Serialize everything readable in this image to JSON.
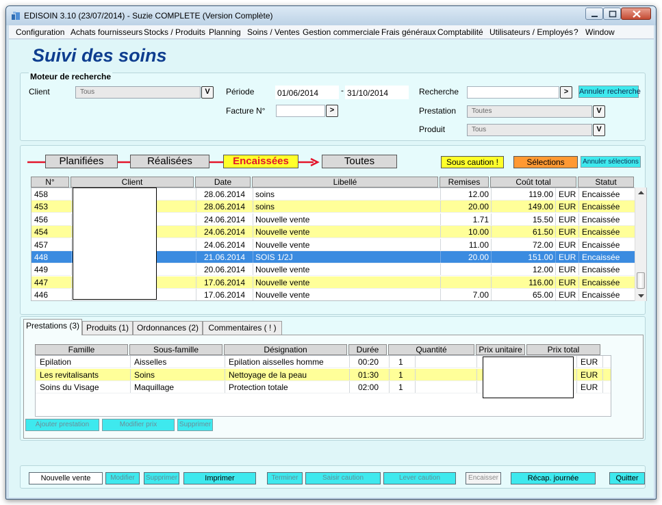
{
  "window": {
    "title": "EDISOIN 3.10 (23/07/2014) - Suzie COMPLETE (Version Complète)"
  },
  "menu": [
    "Configuration",
    "Achats fournisseurs",
    "Stocks / Produits",
    "Planning",
    "Soins / Ventes",
    "Gestion commerciale",
    "Frais généraux",
    "Comptabilité",
    "Utilisateurs / Employés",
    "?",
    "Window"
  ],
  "page_title": "Suivi des soins",
  "search": {
    "group_title": "Moteur de recherche",
    "client_label": "Client",
    "client_value": "Tous",
    "combo_btn": "V",
    "periode_label": "Période",
    "date_from": "01/06/2014",
    "date_sep": "-",
    "date_to": "31/10/2014",
    "facture_label": "Facture N°",
    "facture_value": "",
    "go_btn": ">",
    "recherche_label": "Recherche",
    "recherche_value": "",
    "annuler_recherche": "Annuler recherche",
    "prestation_label": "Prestation",
    "prestation_value": "Toutes",
    "produit_label": "Produit",
    "produit_value": "Tous"
  },
  "filters": {
    "planifiees": "Planifiées",
    "realisees": "Réalisées",
    "encaissees": "Encaissées",
    "toutes": "Toutes",
    "active": "encaissees",
    "sous_caution": "Sous caution !",
    "selections": "Sélections",
    "annuler_selections": "Annuler sélections"
  },
  "colors": {
    "accent_cyan": "#3ee9ee",
    "row_yellow": "#ffff99",
    "row_selected": "#3b8be0",
    "title_blue": "#0e3d8f",
    "filter_red": "#e3152b",
    "tag_yellow": "#ffff2a",
    "tag_orange": "#ff9933"
  },
  "soins_table": {
    "headers": [
      "N°",
      "Client",
      "Date",
      "Libellé",
      "Remises",
      "Coût total",
      "Statut"
    ],
    "rows": [
      {
        "no": "458",
        "date": "28.06.2014",
        "libelle": "soins",
        "remises": "12.00",
        "cout": "119.00",
        "devise": "EUR",
        "statut": "Encaissée",
        "style": "white"
      },
      {
        "no": "453",
        "date": "28.06.2014",
        "libelle": "soins",
        "remises": "20.00",
        "cout": "149.00",
        "devise": "EUR",
        "statut": "Encaissée",
        "style": "yellow"
      },
      {
        "no": "456",
        "date": "24.06.2014",
        "libelle": "Nouvelle vente",
        "remises": "1.71",
        "cout": "15.50",
        "devise": "EUR",
        "statut": "Encaissée",
        "style": "white"
      },
      {
        "no": "454",
        "date": "24.06.2014",
        "libelle": "Nouvelle vente",
        "remises": "10.00",
        "cout": "61.50",
        "devise": "EUR",
        "statut": "Encaissée",
        "style": "yellow"
      },
      {
        "no": "457",
        "date": "24.06.2014",
        "libelle": "Nouvelle vente",
        "remises": "11.00",
        "cout": "72.00",
        "devise": "EUR",
        "statut": "Encaissée",
        "style": "white"
      },
      {
        "no": "448",
        "date": "21.06.2014",
        "libelle": "SOIS 1/2J",
        "remises": "20.00",
        "cout": "151.00",
        "devise": "EUR",
        "statut": "Encaissée",
        "style": "sel"
      },
      {
        "no": "449",
        "date": "20.06.2014",
        "libelle": "Nouvelle vente",
        "remises": "",
        "cout": "12.00",
        "devise": "EUR",
        "statut": "Encaissée",
        "style": "white"
      },
      {
        "no": "447",
        "date": "17.06.2014",
        "libelle": "Nouvelle vente",
        "remises": "",
        "cout": "116.00",
        "devise": "EUR",
        "statut": "Encaissée",
        "style": "yellow"
      },
      {
        "no": "446",
        "date": "17.06.2014",
        "libelle": "Nouvelle vente",
        "remises": "7.00",
        "cout": "65.00",
        "devise": "EUR",
        "statut": "Encaissée",
        "style": "white"
      }
    ]
  },
  "detail_tabs": [
    "Prestations (3)",
    "Produits (1)",
    "Ordonnances (2)",
    "Commentaires ( ! )"
  ],
  "prestations_table": {
    "headers": [
      "Famille",
      "Sous-famille",
      "Désignation",
      "Durée",
      "Quantité",
      "Prix unitaire",
      "Prix total"
    ],
    "rows": [
      {
        "famille": "Epilation",
        "sous_famille": "Aisselles",
        "designation": "Epilation aisselles homme",
        "duree": "00:20",
        "quantite": "1",
        "devise": "EUR",
        "style": "white"
      },
      {
        "famille": "Les revitalisants",
        "sous_famille": "Soins",
        "designation": "Nettoyage de la peau",
        "duree": "01:30",
        "quantite": "1",
        "devise": "EUR",
        "style": "yellow"
      },
      {
        "famille": "Soins du Visage",
        "sous_famille": "Maquillage",
        "designation": "Protection totale",
        "duree": "02:00",
        "quantite": "1",
        "devise": "EUR",
        "style": "white"
      }
    ]
  },
  "detail_buttons": {
    "ajouter": "Ajouter prestation",
    "modifier_prix": "Modifier prix",
    "supprimer": "Supprimer"
  },
  "bottom_buttons": {
    "nouvelle_vente": "Nouvelle vente",
    "modifier": "Modifier",
    "supprimer": "Supprimer",
    "imprimer": "Imprimer",
    "terminer": "Terminer",
    "saisir_caution": "Saisir caution",
    "lever_caution": "Lever caution",
    "encaisser": "Encaisser",
    "recap": "Récap. journée",
    "quitter": "Quitter"
  }
}
